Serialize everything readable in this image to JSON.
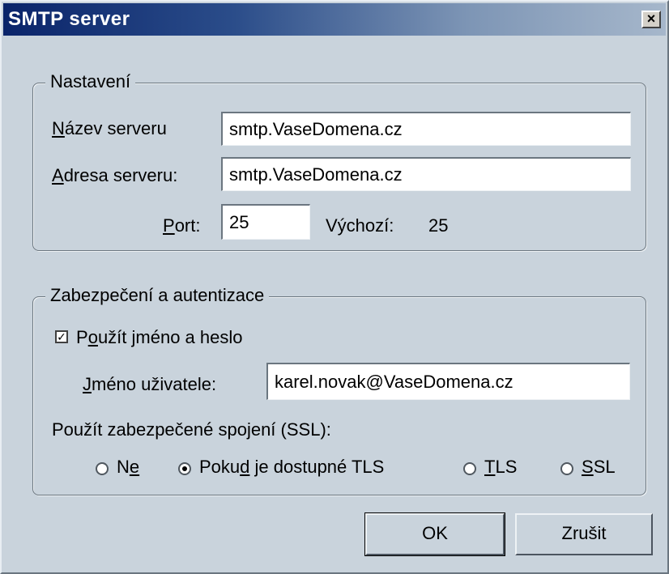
{
  "window": {
    "title": "SMTP server",
    "close_glyph": "×"
  },
  "settings": {
    "legend": "Nastavení",
    "server_name_label_u": "N",
    "server_name_label_rest": "ázev serveru",
    "server_name_value": "smtp.VaseDomena.cz",
    "server_address_label_u": "A",
    "server_address_label_rest": "dresa serveru:",
    "server_address_value": "smtp.VaseDomena.cz",
    "port_label_u": "P",
    "port_label_rest": "ort:",
    "port_value": "25",
    "default_label": "Výchozí:",
    "default_value": "25"
  },
  "security": {
    "legend": "Zabezpečení a autentizace",
    "use_auth_checked": true,
    "use_auth_check_glyph": "✓",
    "use_auth_label_pre": "P",
    "use_auth_label_u": "o",
    "use_auth_label_rest": "užít jméno a heslo",
    "username_label_u": "J",
    "username_label_rest": "méno uživatele:",
    "username_value": "karel.novak@VaseDomena.cz",
    "ssl_label": "Použít zabezpečené spojení (SSL):",
    "ssl_options": [
      {
        "pre": "N",
        "u": "e",
        "rest": "",
        "checked": false
      },
      {
        "pre": "Poku",
        "u": "d",
        "rest": " je dostupné TLS",
        "checked": true
      },
      {
        "pre": "",
        "u": "T",
        "rest": "LS",
        "checked": false
      },
      {
        "pre": "",
        "u": "S",
        "rest": "SL",
        "checked": false
      }
    ]
  },
  "buttons": {
    "ok": "OK",
    "cancel": "Zrušit"
  }
}
